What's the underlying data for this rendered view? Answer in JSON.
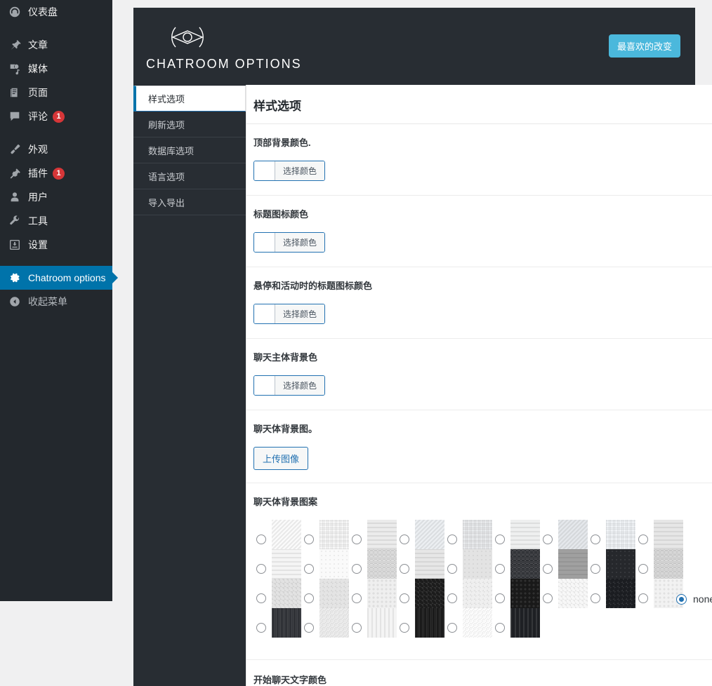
{
  "sidebar": {
    "items": [
      {
        "label": "仪表盘",
        "icon": "dashboard-icon",
        "badge": null,
        "active": false,
        "gap_after": true
      },
      {
        "label": "文章",
        "icon": "pin-icon",
        "badge": null,
        "active": false,
        "gap_after": false
      },
      {
        "label": "媒体",
        "icon": "media-icon",
        "badge": null,
        "active": false,
        "gap_after": false
      },
      {
        "label": "页面",
        "icon": "pages-icon",
        "badge": null,
        "active": false,
        "gap_after": false
      },
      {
        "label": "评论",
        "icon": "comments-icon",
        "badge": "1",
        "active": false,
        "gap_after": true
      },
      {
        "label": "外观",
        "icon": "appearance-brush-icon",
        "badge": null,
        "active": false,
        "gap_after": false
      },
      {
        "label": "插件",
        "icon": "plugins-plug-icon",
        "badge": "1",
        "active": false,
        "gap_after": false
      },
      {
        "label": "用户",
        "icon": "users-icon",
        "badge": null,
        "active": false,
        "gap_after": false
      },
      {
        "label": "工具",
        "icon": "tools-wrench-icon",
        "badge": null,
        "active": false,
        "gap_after": false
      },
      {
        "label": "设置",
        "icon": "settings-sliders-icon",
        "badge": null,
        "active": false,
        "gap_after": true
      },
      {
        "label": "Chatroom options",
        "icon": "gear-icon",
        "badge": null,
        "active": true,
        "gap_after": false
      },
      {
        "label": "收起菜单",
        "icon": "collapse-arrow-icon",
        "badge": null,
        "active": false,
        "gap_after": false
      }
    ],
    "colors": {
      "background": "#23282d",
      "active": "#0073aa",
      "badge": "#d63638"
    }
  },
  "header": {
    "title": "CHATROOM OPTIONS",
    "logo_icon": "eye-lens-logo-icon",
    "favorite_button": "最喜欢的改变",
    "accent": "#4bb8dc",
    "background": "#282d33"
  },
  "tabs": [
    {
      "label": "样式选项",
      "active": true
    },
    {
      "label": "刷新选项",
      "active": false
    },
    {
      "label": "数据库选项",
      "active": false
    },
    {
      "label": "语言选项",
      "active": false
    },
    {
      "label": "导入导出",
      "active": false
    }
  ],
  "content": {
    "title": "样式选项",
    "pick_color_label": "选择颜色",
    "upload_image_label": "上传图像",
    "none_label": "none",
    "fields": [
      {
        "label": "顶部背景颜色.",
        "type": "color",
        "value": "#ffffff"
      },
      {
        "label": "标题图标颜色",
        "type": "color",
        "value": "#ffffff"
      },
      {
        "label": "悬停和活动时的标题图标颜色",
        "type": "color",
        "value": "#ffffff"
      },
      {
        "label": "聊天主体背景色",
        "type": "color",
        "value": "#ffffff"
      },
      {
        "label": "聊天体背景图。",
        "type": "upload"
      },
      {
        "label": "聊天体背景图案",
        "type": "pattern-grid"
      }
    ],
    "trailing_label": "开始聊天文字颜色",
    "pattern_grid": {
      "selected": "none",
      "columns": [
        [
          "#fbfbfb",
          "#f4f4f4",
          "#e2e2e2",
          "#2f3136"
        ],
        [
          "#f6f6f6",
          "#fafafa",
          "#e4e4e4",
          "#ededed"
        ],
        [
          "#ebebeb",
          "#e0e0e0",
          "#efefef",
          "#f4f4f4"
        ],
        [
          "#eceff2",
          "#e6e6e6",
          "#1c1c1c",
          "#1a1a1a"
        ],
        [
          "#e8eaec",
          "#e3e3e3",
          "#efefef",
          "#fdfdfd"
        ],
        [
          "#eeefef",
          "#2b2d31",
          "#191919",
          "#1e2024"
        ],
        [
          "#e5e8ec",
          "#a0a0a0",
          "#f7f7f7",
          null
        ],
        [
          "#eff2f5",
          "#26282c",
          "#1b1d21",
          null
        ],
        [
          "#e6e6e6",
          "#dcdcdc",
          "#f2f2f2",
          null
        ]
      ]
    }
  }
}
